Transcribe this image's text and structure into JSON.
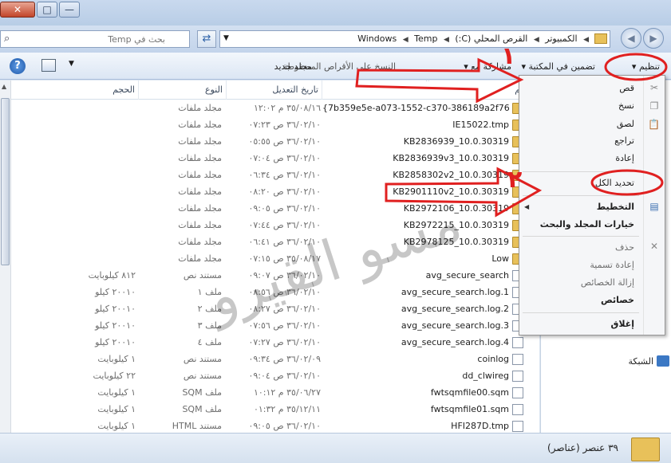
{
  "window": {
    "close_symbol": "✕",
    "maximize_symbol": "□",
    "minimize_symbol": "—"
  },
  "address": {
    "crumbs": [
      "الكمبيوتر",
      "القرص المحلي (C:)",
      "Windows",
      "Temp"
    ],
    "search_placeholder": "بحث في Temp"
  },
  "toolbar": {
    "organize": "تنظيم",
    "include_in_library": "تضمين في المكتبة",
    "share_with": "مشاركة مع",
    "burn": "النسخ على الأقراص المضغوطة",
    "new_folder": "مجلد جديد"
  },
  "columns": {
    "name": "الاسم",
    "date": "تاريخ التعديل",
    "type": "النوع",
    "size": "الحجم"
  },
  "files": [
    {
      "name": "{7b359e5e-a073-1552-c370-386189a2f76d}",
      "date": "٣٥/٠٨/١٦ م ١٢:٠٢",
      "type": "مجلد ملفات",
      "size": "",
      "kind": "folder"
    },
    {
      "name": "IE15022.tmp",
      "date": "٣٦/٠٢/١٠ ص ٠٧:٢٣",
      "type": "مجلد ملفات",
      "size": "",
      "kind": "folder"
    },
    {
      "name": "KB2836939_10.0.30319",
      "date": "٣٦/٠٢/١٠ ص ٠٥:٥٥",
      "type": "مجلد ملفات",
      "size": "",
      "kind": "folder"
    },
    {
      "name": "KB2836939v3_10.0.30319",
      "date": "٣٦/٠٢/١٠ ص ٠٧:٠٤",
      "type": "مجلد ملفات",
      "size": "",
      "kind": "folder"
    },
    {
      "name": "KB2858302v2_10.0.30319",
      "date": "٣٦/٠٢/١٠ ص ٠٦:٣٤",
      "type": "مجلد ملفات",
      "size": "",
      "kind": "folder"
    },
    {
      "name": "KB2901110v2_10.0.30319",
      "date": "٣٦/٠٢/١٠ ص ٠٨:٢٠",
      "type": "مجلد ملفات",
      "size": "",
      "kind": "folder"
    },
    {
      "name": "KB2972106_10.0.30319",
      "date": "٣٦/٠٢/١٠ ص ٠٩:٠٥",
      "type": "مجلد ملفات",
      "size": "",
      "kind": "folder"
    },
    {
      "name": "KB2972215_10.0.30319",
      "date": "٣٦/٠٢/١٠ ص ٠٧:٤٤",
      "type": "مجلد ملفات",
      "size": "",
      "kind": "folder"
    },
    {
      "name": "KB2978125_10.0.30319",
      "date": "٣٦/٠٢/١٠ ص ٠٦:٤١",
      "type": "مجلد ملفات",
      "size": "",
      "kind": "folder"
    },
    {
      "name": "Low",
      "date": "٣٥/٠٨/١٧ ص ٠٧:١٥",
      "type": "مجلد ملفات",
      "size": "",
      "kind": "folder"
    },
    {
      "name": "avg_secure_search",
      "date": "٣٦/٠٢/١٠ ص ٠٩:٠٧",
      "type": "مستند نص",
      "size": "٨١٢ كيلوبايت",
      "kind": "file"
    },
    {
      "name": "avg_secure_search.log.1",
      "date": "٣٦/٠٢/١٠ ص ٠٨:٥٦",
      "type": "ملف ١",
      "size": "٢٠٠١٠ كيلو",
      "kind": "file"
    },
    {
      "name": "avg_secure_search.log.2",
      "date": "٣٦/٠٢/١٠ ص ٠٨:٢٧",
      "type": "ملف ٢",
      "size": "٢٠٠١٠ كيلو",
      "kind": "file"
    },
    {
      "name": "avg_secure_search.log.3",
      "date": "٣٦/٠٢/١٠ ص ٠٧:٥٦",
      "type": "ملف ٣",
      "size": "٢٠٠١٠ كيلو",
      "kind": "file"
    },
    {
      "name": "avg_secure_search.log.4",
      "date": "٣٦/٠٢/١٠ ص ٠٧:٢٧",
      "type": "ملف ٤",
      "size": "٢٠٠١٠ كيلو",
      "kind": "file"
    },
    {
      "name": "coinlog",
      "date": "٣٦/٠٢/٠٩ ص ٠٩:٣٤",
      "type": "مستند نص",
      "size": "١ كيلوبايت",
      "kind": "file"
    },
    {
      "name": "dd_clwireg",
      "date": "٣٦/٠٢/١٠ ص ٠٩:٠٤",
      "type": "مستند نص",
      "size": "٢٢ كيلوبايت",
      "kind": "file"
    },
    {
      "name": "fwtsqmfile00.sqm",
      "date": "٣٥/٠٦/٢٧ م ١٠:١٢",
      "type": "ملف SQM",
      "size": "١ كيلوبايت",
      "kind": "file"
    },
    {
      "name": "fwtsqmfile01.sqm",
      "date": "٣٥/١٢/١١ م ٠١:٣٢",
      "type": "ملف SQM",
      "size": "١ كيلوبايت",
      "kind": "file"
    },
    {
      "name": "HFI287D.tmp",
      "date": "٣٦/٠٢/١٠ ص ٠٩:٠٥",
      "type": "مستند HTML",
      "size": "١ كيلوبايت",
      "kind": "file"
    }
  ],
  "menu": {
    "items": [
      {
        "label": "قص",
        "enabled": true,
        "bold": false
      },
      {
        "label": "نسخ",
        "enabled": true,
        "bold": false
      },
      {
        "label": "لصق",
        "enabled": true,
        "bold": false
      },
      {
        "label": "تراجع",
        "enabled": true,
        "bold": false
      },
      {
        "label": "إعادة",
        "enabled": true,
        "bold": false
      },
      {
        "label": "تحديد الكل",
        "enabled": true,
        "bold": false
      },
      {
        "label": "التخطيط",
        "enabled": true,
        "bold": true
      },
      {
        "label": "خيارات المجلد والبحث",
        "enabled": true,
        "bold": true
      },
      {
        "label": "حذف",
        "enabled": false,
        "bold": false
      },
      {
        "label": "إعادة تسمية",
        "enabled": false,
        "bold": false
      },
      {
        "label": "إزالة الخصائص",
        "enabled": false,
        "bold": false
      },
      {
        "label": "خصائص",
        "enabled": true,
        "bold": true
      },
      {
        "label": "إغلاق",
        "enabled": true,
        "bold": true
      }
    ]
  },
  "navpane": {
    "network": "الشبكة"
  },
  "status": {
    "count": "٣٩ عنصر (عناصر)"
  },
  "annotations": {
    "badge_1": "١",
    "badge_2": "٢",
    "watermark": "مسو القيرو",
    "annotation_color": "#e02020",
    "watermark_color": "#000000"
  }
}
